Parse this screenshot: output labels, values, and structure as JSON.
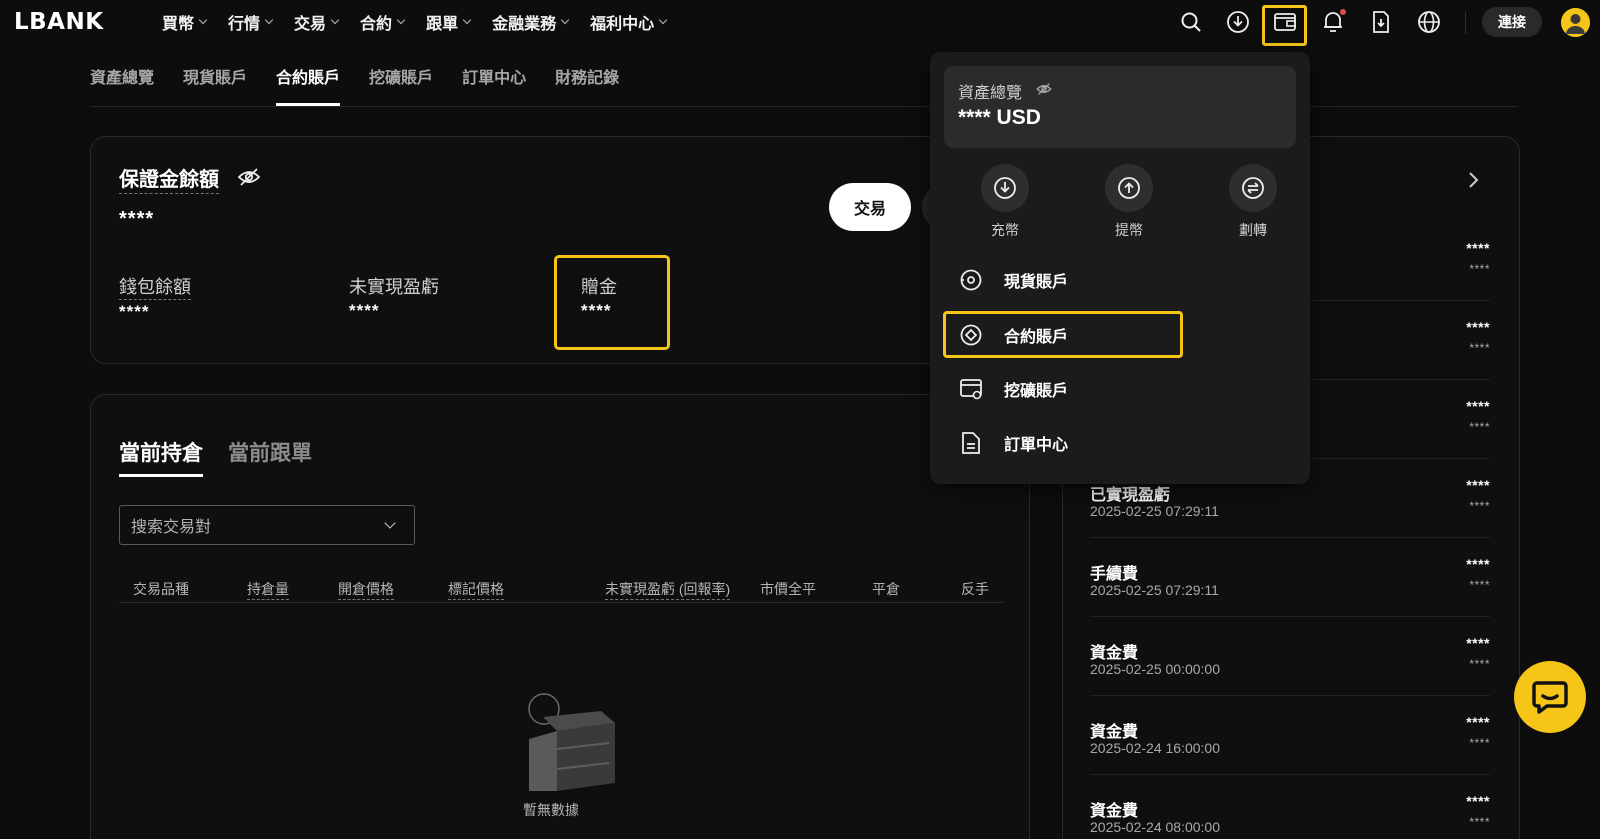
{
  "brand": {
    "logo_text": "LBANK",
    "accent": "#f5c518"
  },
  "nav": {
    "items": [
      "買幣",
      "行情",
      "交易",
      "合約",
      "跟單",
      "金融業務",
      "福利中心"
    ],
    "connect_label": "連接",
    "icons": [
      "search-icon",
      "download-icon",
      "wallet-icon",
      "bell-icon",
      "doc-download-icon",
      "globe-icon"
    ]
  },
  "subtabs": [
    "資產總覽",
    "現貨賬戶",
    "合約賬戶",
    "挖礦賬戶",
    "訂單中心",
    "財務記錄"
  ],
  "margin_card": {
    "title": "保證金餘額",
    "value": "****",
    "trade_label": "交易",
    "metrics": [
      {
        "label": "錢包餘額",
        "value": "****"
      },
      {
        "label": "未實現盈虧",
        "value": "****"
      },
      {
        "label": "贈金",
        "value": "****"
      }
    ]
  },
  "positions": {
    "tabs": [
      "當前持倉",
      "當前跟單"
    ],
    "search_placeholder": "搜索交易對",
    "columns": [
      "交易品種",
      "持倉量",
      "開倉價格",
      "標記價格",
      "未實現盈虧 (回報率)",
      "市價全平",
      "平倉",
      "反手"
    ],
    "empty_text": "暫無數據"
  },
  "records": {
    "rows": [
      {
        "title": "",
        "date": "",
        "v1": "****",
        "v2": "****"
      },
      {
        "title": "",
        "date": "",
        "v1": "****",
        "v2": "****"
      },
      {
        "title": "",
        "date": "",
        "v1": "****",
        "v2": "****"
      },
      {
        "title": "已實現盈虧",
        "date": "2025-02-25 07:29:11",
        "v1": "****",
        "v2": "****"
      },
      {
        "title": "手續費",
        "date": "2025-02-25 07:29:11",
        "v1": "****",
        "v2": "****"
      },
      {
        "title": "資金費",
        "date": "2025-02-25 00:00:00",
        "v1": "****",
        "v2": "****"
      },
      {
        "title": "資金費",
        "date": "2025-02-24 16:00:00",
        "v1": "****",
        "v2": "****"
      },
      {
        "title": "資金費",
        "date": "2025-02-24 08:00:00",
        "v1": "****",
        "v2": "****"
      }
    ]
  },
  "dropdown": {
    "overview_title": "資產總覽",
    "overview_value": "**** USD",
    "actions": [
      "充幣",
      "提幣",
      "劃轉"
    ],
    "items": [
      "現貨賬戶",
      "合約賬戶",
      "挖礦賬戶",
      "訂單中心"
    ]
  }
}
